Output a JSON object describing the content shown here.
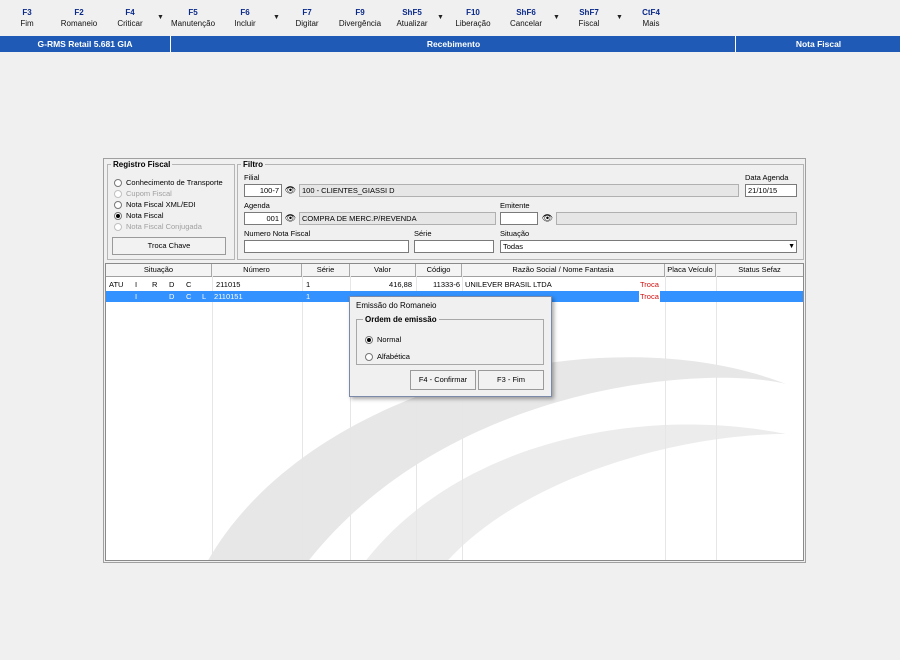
{
  "toolbar": [
    {
      "key": "F3",
      "label": "Fim"
    },
    {
      "key": "F2",
      "label": "Romaneio"
    },
    {
      "key": "F4",
      "label": "Criticar"
    },
    {
      "key": "F5",
      "label": "Manutenção"
    },
    {
      "key": "F6",
      "label": "Incluir"
    },
    {
      "key": "F7",
      "label": "Digitar"
    },
    {
      "key": "F9",
      "label": "Divergência"
    },
    {
      "key": "ShF5",
      "label": "Atualizar"
    },
    {
      "key": "F10",
      "label": "Liberação"
    },
    {
      "key": "ShF6",
      "label": "Cancelar"
    },
    {
      "key": "ShF7",
      "label": "Fiscal"
    },
    {
      "key": "CtF4",
      "label": "Mais"
    }
  ],
  "statusbar": {
    "app": "G-RMS Retail 5.681 GIA",
    "module": "Recebimento",
    "screen": "Nota Fiscal"
  },
  "registro": {
    "legend": "Registro Fiscal",
    "options": [
      {
        "label": "Conhecimento de Transporte",
        "selected": false,
        "disabled": false
      },
      {
        "label": "Cupom Fiscal",
        "selected": false,
        "disabled": true
      },
      {
        "label": "Nota Fiscal XML/EDI",
        "selected": false,
        "disabled": false
      },
      {
        "label": "Nota Fiscal",
        "selected": true,
        "disabled": false
      },
      {
        "label": "Nota Fiscal Conjugada",
        "selected": false,
        "disabled": true
      }
    ],
    "troca_button": "Troca Chave"
  },
  "filtro": {
    "legend": "Filtro",
    "filial_label": "Filial",
    "filial_code": "100-7",
    "filial_name": "100 - CLIENTES_GIASSI D",
    "data_label": "Data Agenda",
    "data_value": "21/10/15",
    "agenda_label": "Agenda",
    "agenda_code": "001",
    "agenda_name": "COMPRA DE MERC.P/REVENDA",
    "emitente_label": "Emitente",
    "emitente_code": "",
    "emitente_name": "",
    "nf_label": "Numero Nota Fiscal",
    "nf_value": "",
    "serie_label": "Série",
    "serie_value": "",
    "situacao_label": "Situação",
    "situacao_value": "Todas"
  },
  "grid": {
    "headers": [
      "Situação",
      "Número",
      "Série",
      "Valor",
      "Código",
      "Razão Social / Nome Fantasia",
      "Placa Veículo",
      "Status Sefaz"
    ],
    "rows": [
      {
        "flags": [
          "ATU",
          "I",
          "R",
          "D",
          "C",
          ""
        ],
        "numero": "211015",
        "serie": "1",
        "valor": "416,88",
        "codigo": "11333-6",
        "razao": "UNILEVER BRASIL LTDA",
        "tag": "Troca",
        "selected": false
      },
      {
        "flags": [
          "",
          "I",
          "",
          "D",
          "C",
          "L"
        ],
        "numero": "2110151",
        "serie": "1",
        "valor": "",
        "codigo": "",
        "razao": "",
        "tag": "Troca",
        "selected": true
      }
    ]
  },
  "dialog": {
    "title": "Emissão do Romaneio",
    "legend": "Ordem de emissão",
    "opt_normal": "Normal",
    "opt_alfa": "Alfabética",
    "confirm": "F4 - Confirmar",
    "fim": "F3 - Fim"
  },
  "colors": {
    "statusbar": "#1f5bb6",
    "selection": "#3392ff",
    "troca": "#d01010"
  }
}
